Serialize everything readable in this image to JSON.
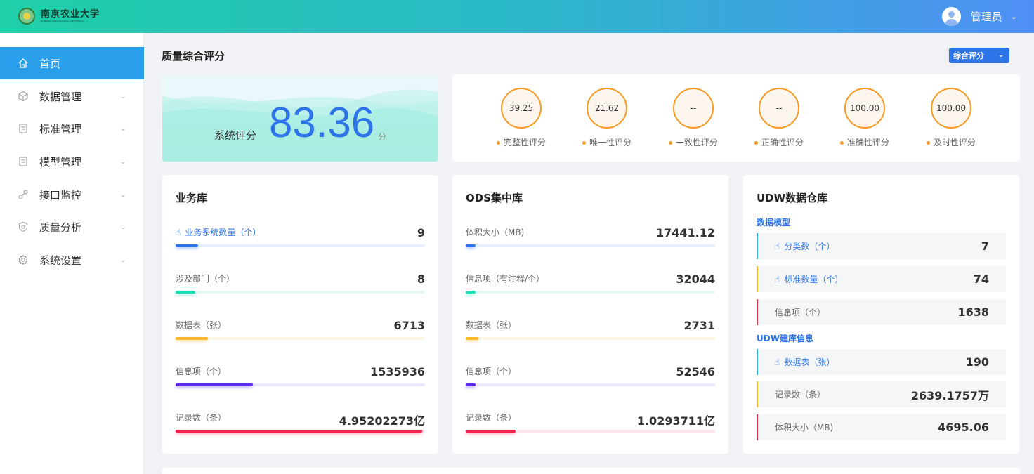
{
  "header": {
    "logo_cn": "南京农业大学",
    "logo_en": "NANJING AGRICULTURAL UNIVERSITY",
    "user_name": "管理员"
  },
  "sidebar": {
    "items": [
      {
        "label": "首页",
        "icon": "home-icon",
        "active": true
      },
      {
        "label": "数据管理",
        "icon": "cube-icon"
      },
      {
        "label": "标准管理",
        "icon": "document-icon"
      },
      {
        "label": "模型管理",
        "icon": "document-icon"
      },
      {
        "label": "接口监控",
        "icon": "link-icon"
      },
      {
        "label": "质量分析",
        "icon": "shield-icon"
      },
      {
        "label": "系统设置",
        "icon": "gear-icon"
      }
    ]
  },
  "quality": {
    "title": "质量综合评分",
    "select_value": "综合评分",
    "score_label": "系统评分",
    "score_value": "83.36",
    "score_unit": "分",
    "metrics": [
      {
        "value": "39.25",
        "label": "完整性评分"
      },
      {
        "value": "21.62",
        "label": "唯一性评分"
      },
      {
        "value": "--",
        "label": "一致性评分"
      },
      {
        "value": "--",
        "label": "正确性评分"
      },
      {
        "value": "100.00",
        "label": "准确性评分"
      },
      {
        "value": "100.00",
        "label": "及时性评分"
      }
    ]
  },
  "business": {
    "title": "业务库",
    "rows": [
      {
        "label": "业务系统数量（个）",
        "value": "9",
        "fill": 0.09,
        "color": "#2d74e8",
        "track": "#e6effc",
        "link": true
      },
      {
        "label": "涉及部门（个）",
        "value": "8",
        "fill": 0.08,
        "color": "#1ee0b5",
        "track": "#e6faf5"
      },
      {
        "label": "数据表（张）",
        "value": "6713",
        "fill": 0.13,
        "color": "#fbb92b",
        "track": "#fef6e4"
      },
      {
        "label": "信息项（个）",
        "value": "1535936",
        "fill": 0.31,
        "color": "#5b2df0",
        "track": "#ece8fb"
      },
      {
        "label": "记录数（条）",
        "value": "4.95202273亿",
        "fill": 0.99,
        "color": "#f5234f",
        "track": "#fde7ec"
      }
    ]
  },
  "ods": {
    "title": "ODS集中库",
    "rows": [
      {
        "label": "体积大小（MB)",
        "value": "17441.12",
        "fill": 0.04,
        "color": "#2d74e8",
        "track": "#e6effc"
      },
      {
        "label": "信息项（有注释/个）",
        "value": "32044",
        "fill": 0.04,
        "color": "#1ee0b5",
        "track": "#e6faf5"
      },
      {
        "label": "数据表（张）",
        "value": "2731",
        "fill": 0.05,
        "color": "#fbb92b",
        "track": "#fef6e4"
      },
      {
        "label": "信息项（个）",
        "value": "52546",
        "fill": 0.04,
        "color": "#5b2df0",
        "track": "#ece8fb"
      },
      {
        "label": "记录数（条）",
        "value": "1.0293711亿",
        "fill": 0.2,
        "color": "#f5234f",
        "track": "#fde7ec"
      }
    ]
  },
  "udw": {
    "title": "UDW数据仓库",
    "model_sub": "数据模型",
    "build_sub": "UDW建库信息",
    "rows": [
      {
        "label": "分类数（个）",
        "value": "7",
        "border": "#29b6e8",
        "link": true
      },
      {
        "label": "标准数量（个）",
        "value": "74",
        "border": "#fbb92b",
        "link": true
      },
      {
        "label": "信息项（个）",
        "value": "1638",
        "border": "#e8344d"
      },
      {
        "label": "数据表（张）",
        "value": "190",
        "border": "#29b6e8",
        "link": true
      },
      {
        "label": "记录数（条）",
        "value": "2639.1757万",
        "border": "#fbb92b"
      },
      {
        "label": "体积大小（MB)",
        "value": "4695.06",
        "border": "#e8344d"
      }
    ]
  }
}
